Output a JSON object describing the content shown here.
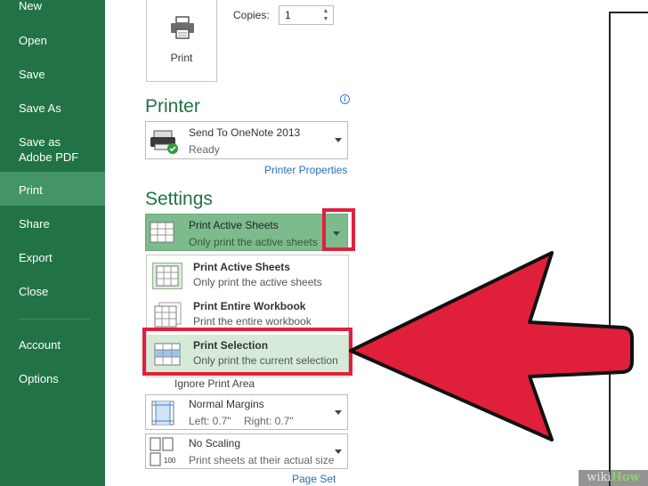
{
  "nav": {
    "items": [
      {
        "label": "New"
      },
      {
        "label": "Open"
      },
      {
        "label": "Save"
      },
      {
        "label": "Save As"
      },
      {
        "label": "Save as Adobe PDF"
      },
      {
        "label": "Print"
      },
      {
        "label": "Share"
      },
      {
        "label": "Export"
      },
      {
        "label": "Close"
      },
      {
        "label": "Account"
      },
      {
        "label": "Options"
      }
    ],
    "active": "Print"
  },
  "print": {
    "button_label": "Print",
    "copies_label": "Copies:",
    "copies_value": "1"
  },
  "printer": {
    "heading": "Printer",
    "name": "Send To OneNote 2013",
    "status": "Ready",
    "properties_link": "Printer Properties"
  },
  "settings": {
    "heading": "Settings",
    "selected_title": "Print Active Sheets",
    "selected_desc": "Only print the active sheets",
    "options": [
      {
        "title": "Print Active Sheets",
        "desc": "Only print the active sheets"
      },
      {
        "title": "Print Entire Workbook",
        "desc": "Print the entire workbook"
      },
      {
        "title": "Print Selection",
        "desc": "Only print the current selection"
      }
    ],
    "ignore_print_area": "Ignore Print Area",
    "margins_title": "Normal Margins",
    "margins_left": "Left:  0.7\"",
    "margins_right": "Right:  0.7\"",
    "scaling_title": "No Scaling",
    "scaling_desc": "Print sheets at their actual size",
    "scaling_icon_text": "100",
    "page_setup_partial": "Page Set"
  },
  "watermark": {
    "part1": "wiki",
    "part2": "How"
  },
  "colors": {
    "nav_bg": "#217346",
    "nav_active": "#439467",
    "accent": "#217346",
    "highlight": "#e0203b",
    "selected_bg": "#7dbb8d"
  }
}
